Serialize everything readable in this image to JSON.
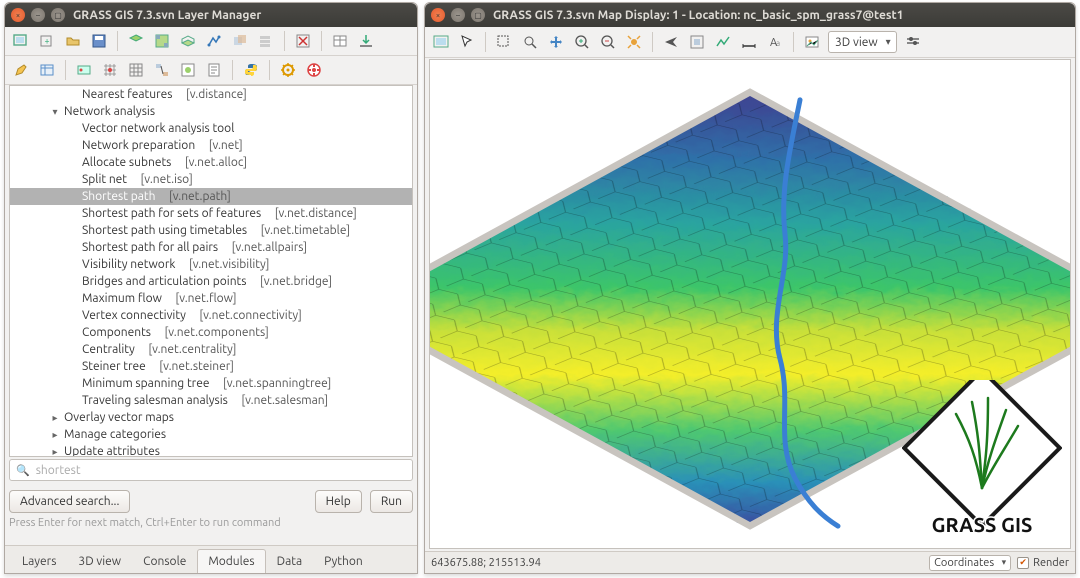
{
  "layer_manager": {
    "title": "GRASS GIS 7.3.svn Layer Manager",
    "tree": [
      {
        "indent": 2,
        "expander": "",
        "label": "Nearest features",
        "module": "[v.distance]",
        "sel": false
      },
      {
        "indent": 1,
        "expander": "▾",
        "label": "Network analysis",
        "module": "",
        "sel": false
      },
      {
        "indent": 2,
        "expander": "",
        "label": "Vector network analysis tool",
        "module": "",
        "sel": false
      },
      {
        "indent": 2,
        "expander": "",
        "label": "Network preparation",
        "module": "[v.net]",
        "sel": false
      },
      {
        "indent": 2,
        "expander": "",
        "label": "Allocate subnets",
        "module": "[v.net.alloc]",
        "sel": false
      },
      {
        "indent": 2,
        "expander": "",
        "label": "Split net",
        "module": "[v.net.iso]",
        "sel": false
      },
      {
        "indent": 2,
        "expander": "",
        "label": "Shortest path",
        "module": "[v.net.path]",
        "sel": true
      },
      {
        "indent": 2,
        "expander": "",
        "label": "Shortest path for sets of features",
        "module": "[v.net.distance]",
        "sel": false
      },
      {
        "indent": 2,
        "expander": "",
        "label": "Shortest path using timetables",
        "module": "[v.net.timetable]",
        "sel": false
      },
      {
        "indent": 2,
        "expander": "",
        "label": "Shortest path for all pairs",
        "module": "[v.net.allpairs]",
        "sel": false
      },
      {
        "indent": 2,
        "expander": "",
        "label": "Visibility network",
        "module": "[v.net.visibility]",
        "sel": false
      },
      {
        "indent": 2,
        "expander": "",
        "label": "Bridges and articulation points",
        "module": "[v.net.bridge]",
        "sel": false
      },
      {
        "indent": 2,
        "expander": "",
        "label": "Maximum flow",
        "module": "[v.net.flow]",
        "sel": false
      },
      {
        "indent": 2,
        "expander": "",
        "label": "Vertex connectivity",
        "module": "[v.net.connectivity]",
        "sel": false
      },
      {
        "indent": 2,
        "expander": "",
        "label": "Components",
        "module": "[v.net.components]",
        "sel": false
      },
      {
        "indent": 2,
        "expander": "",
        "label": "Centrality",
        "module": "[v.net.centrality]",
        "sel": false
      },
      {
        "indent": 2,
        "expander": "",
        "label": "Steiner tree",
        "module": "[v.net.steiner]",
        "sel": false
      },
      {
        "indent": 2,
        "expander": "",
        "label": "Minimum spanning tree",
        "module": "[v.net.spanningtree]",
        "sel": false
      },
      {
        "indent": 2,
        "expander": "",
        "label": "Traveling salesman analysis",
        "module": "[v.net.salesman]",
        "sel": false
      },
      {
        "indent": 1,
        "expander": "▸",
        "label": "Overlay vector maps",
        "module": "",
        "sel": false
      },
      {
        "indent": 1,
        "expander": "▸",
        "label": "Manage categories",
        "module": "",
        "sel": false
      },
      {
        "indent": 1,
        "expander": "▸",
        "label": "Update attributes",
        "module": "",
        "sel": false
      }
    ],
    "search_placeholder": "shortest",
    "advanced_label": "Advanced search...",
    "help_label": "Help",
    "run_label": "Run",
    "hint": "Press Enter for next match, Ctrl+Enter to run command",
    "tabs": [
      "Layers",
      "3D view",
      "Console",
      "Modules",
      "Data",
      "Python"
    ],
    "active_tab": 3
  },
  "map_display": {
    "title": "GRASS GIS 7.3.svn Map Display: 1 - Location: nc_basic_spm_grass7@test1",
    "view_mode": "3D view",
    "coordinates": "643675.88; 215513.94",
    "status_mode": "Coordinates",
    "render_label": "Render",
    "logo_text": "GRASS GIS"
  }
}
